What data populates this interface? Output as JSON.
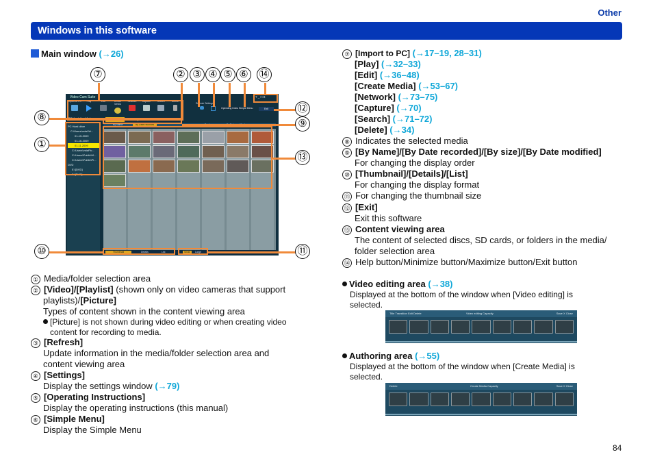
{
  "header": {
    "section": "Other",
    "title": "Windows in this software"
  },
  "main_window": {
    "label": "Main window",
    "ref": "(→26)"
  },
  "app": {
    "title": "Video Cam Suite",
    "toolbar": [
      "Import to PC",
      "Play",
      "Edit",
      "Create Media",
      "Network",
      "Capture",
      "Search",
      "Delete"
    ],
    "refresh_settings": "Refresh  Settings",
    "op_instr": "Operating Instructions",
    "simple_menu": "Simple Menu",
    "exit": "Exit",
    "window_controls": "?  _  □  X",
    "media_mode": "PC Hard drive Mode",
    "tabs": [
      "Video",
      "Playlist",
      "Picture"
    ],
    "sort": [
      "By Name",
      "By Date recorded",
      "By size",
      "By Date modified"
    ],
    "tree": [
      "PC Hard drive",
      "C:\\Users\\vstaVid...",
      "01-15-2009",
      "01-16-2009",
      "01.11.2009",
      "C:\\Users\\vstaPic...",
      "C:\\Users\\Public\\Vi...",
      "C:\\Users\\Public\\Pi...",
      "DVD",
      "E:\\[DVD]",
      "F:\\[DVD]"
    ],
    "view_modes": [
      "Thumbnail",
      "Details",
      "List"
    ],
    "sizes": [
      "Small",
      "Large"
    ]
  },
  "callouts": [
    "①",
    "②",
    "③",
    "④",
    "⑤",
    "⑥",
    "⑦",
    "⑧",
    "⑨",
    "⑩",
    "⑪",
    "⑫",
    "⑬",
    "⑭"
  ],
  "left_items": [
    {
      "num": "①",
      "text": "Media/folder selection area"
    },
    {
      "num": "②",
      "bold1": "[Video]/[Playlist]",
      "rest1": " (shown only on video cameras that support",
      "line2a": "playlists)/",
      "line2b": "[Picture]",
      "desc": "Types of content shown in the content viewing area",
      "note": "[Picture] is not shown during video editing or when creating video",
      "note2": "content for recording to media."
    },
    {
      "num": "③",
      "bold": "[Refresh]",
      "desc": "Update information in the media/folder selection area and",
      "desc2": "content viewing area"
    },
    {
      "num": "④",
      "bold": "[Settings]",
      "desc": "Display the settings window ",
      "ref": "(→79)"
    },
    {
      "num": "⑤",
      "bold": "[Operating Instructions]",
      "desc": "Display the operating instructions (this manual)"
    },
    {
      "num": "⑥",
      "bold": "[Simple Menu]",
      "desc": "Display the Simple Menu"
    }
  ],
  "right_items": {
    "seven": {
      "num": "⑦",
      "entries": [
        {
          "label": "[Import to PC]",
          "ref": "(→17–19, 28–31)"
        },
        {
          "label": "[Play]",
          "ref": "(→32–33)"
        },
        {
          "label": "[Edit]",
          "ref": "(→36–48)"
        },
        {
          "label": "[Create Media]",
          "ref": "(→53–67)"
        },
        {
          "label": "[Network]",
          "ref": "(→73–75)"
        },
        {
          "label": "[Capture]",
          "ref": "(→70)"
        },
        {
          "label": "[Search]",
          "ref": "(→71–72)"
        },
        {
          "label": "[Delete]",
          "ref": "(→34)"
        }
      ]
    },
    "eight": {
      "num": "⑧",
      "text": "Indicates the selected media"
    },
    "nine": {
      "num": "⑨",
      "bold": "[By Name]/[By Date recorded]/[By size]/[By Date modified]",
      "desc": "For changing the display order"
    },
    "ten": {
      "num": "⑩",
      "bold": "[Thumbnail]/[Details]/[List]",
      "desc": "For changing the display format"
    },
    "eleven": {
      "num": "⑪",
      "text": "For changing the thumbnail size"
    },
    "twelve": {
      "num": "⑫",
      "bold": "[Exit]",
      "desc": "Exit this software"
    },
    "thirteen": {
      "num": "⑬",
      "bold": "Content viewing area",
      "desc": "The content of selected discs, SD cards, or folders in the media/",
      "desc2": "folder selection area"
    },
    "fourteen": {
      "num": "⑭",
      "text": "Help button/Minimize button/Maximize button/Exit button"
    }
  },
  "video_editing": {
    "label": "Video editing area",
    "ref": "(→38)",
    "desc": "Displayed at the bottom of the window when [Video editing] is",
    "desc2": "selected.",
    "toolbar": {
      "left": "Title   Transition   Edit     Delete",
      "mid": "Video editing    Capacity",
      "right": "Save    X Close"
    }
  },
  "authoring": {
    "label": "Authoring area",
    "ref": "(→55)",
    "desc": "Displayed at the bottom of the window when [Create Media] is",
    "desc2": "selected.",
    "toolbar": {
      "left": "Delete",
      "mid": "Create Media    Capacity",
      "right": "Save    X Close"
    }
  },
  "page_number": "84"
}
